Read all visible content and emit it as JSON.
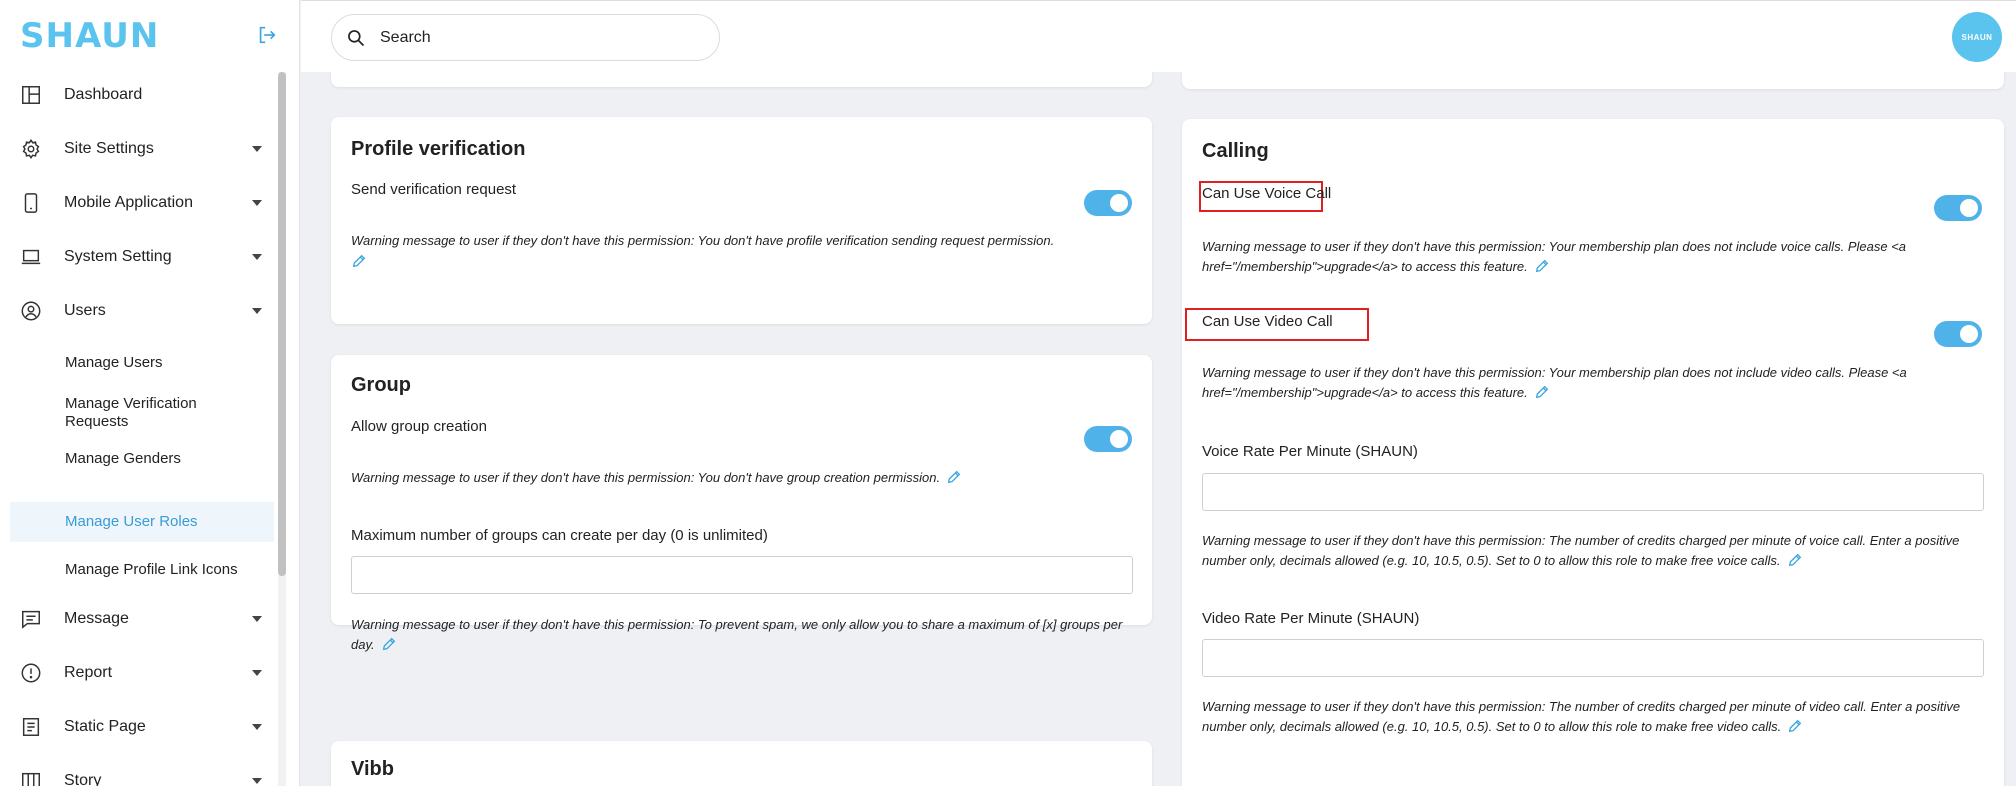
{
  "brand": {
    "logo_text": "SHAUN",
    "avatar_text": "SHAUN",
    "accent": "#5bc4ee",
    "toggle_on": "#4fb3ea",
    "highlight": "#e02020"
  },
  "search": {
    "placeholder": "Search"
  },
  "sidebar": {
    "items": [
      {
        "label": "Dashboard",
        "icon": "dashboard-icon"
      },
      {
        "label": "Site Settings",
        "icon": "gear-icon"
      },
      {
        "label": "Mobile Application",
        "icon": "mobile-icon"
      },
      {
        "label": "System Setting",
        "icon": "laptop-icon"
      },
      {
        "label": "Users",
        "icon": "user-circle-icon"
      },
      {
        "label": "Message",
        "icon": "message-icon"
      },
      {
        "label": "Report",
        "icon": "report-icon"
      },
      {
        "label": "Static Page",
        "icon": "page-icon"
      },
      {
        "label": "Story",
        "icon": "story-icon"
      }
    ],
    "users_sub": [
      {
        "label": "Manage Users"
      },
      {
        "label": "Manage Verification Requests"
      },
      {
        "label": "Manage Genders"
      },
      {
        "label": "Manage User Roles",
        "active": true
      },
      {
        "label": "Manage Profile Link Icons"
      }
    ]
  },
  "profile_verification": {
    "title": "Profile verification",
    "field_label": "Send verification request",
    "enabled": true,
    "warning": "Warning message to user if they don't have this permission: You don't have profile verification sending request permission."
  },
  "group": {
    "title": "Group",
    "allow_label": "Allow group creation",
    "allow_enabled": true,
    "allow_warning": "Warning message to user if they don't have this permission: You don't have group creation permission.",
    "max_label": "Maximum number of groups can create per day (0 is unlimited)",
    "max_value": "",
    "max_warning": "Warning message to user if they don't have this permission: To prevent spam, we only allow you to share a maximum of [x] groups per day."
  },
  "vibb": {
    "title": "Vibb"
  },
  "calling": {
    "title": "Calling",
    "voice_label": "Can Use Voice Call",
    "voice_enabled": true,
    "voice_warning": "Warning message to user if they don't have this permission: Your membership plan does not include voice calls. Please <a href=\"/membership\">upgrade</a> to access this feature.",
    "video_label": "Can Use Video Call",
    "video_enabled": true,
    "video_warning": "Warning message to user if they don't have this permission: Your membership plan does not include video calls. Please <a href=\"/membership\">upgrade</a> to access this feature.",
    "voice_rate_label": "Voice Rate Per Minute (SHAUN)",
    "voice_rate_value": "",
    "voice_rate_warning": "Warning message to user if they don't have this permission: The number of credits charged per minute of voice call. Enter a positive number only, decimals allowed (e.g. 10, 10.5, 0.5). Set to 0 to allow this role to make free voice calls.",
    "video_rate_label": "Video Rate Per Minute (SHAUN)",
    "video_rate_value": "",
    "video_rate_warning": "Warning message to user if they don't have this permission: The number of credits charged per minute of video call. Enter a positive number only, decimals allowed (e.g. 10, 10.5, 0.5). Set to 0 to allow this role to make free video calls."
  }
}
